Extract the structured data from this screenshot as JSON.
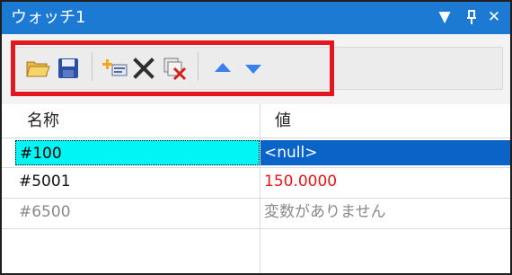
{
  "window": {
    "title": "ウォッチ1",
    "controls": {
      "dropdown": "▼",
      "pin": "ᵖ",
      "close": "✕"
    }
  },
  "toolbar": {
    "buttons": [
      {
        "icon": "open-folder-icon"
      },
      {
        "icon": "save-icon"
      },
      {
        "icon": "add-watch-icon"
      },
      {
        "icon": "delete-icon"
      },
      {
        "icon": "delete-all-icon"
      },
      {
        "icon": "move-up-icon"
      },
      {
        "icon": "move-down-icon"
      }
    ]
  },
  "table": {
    "headers": {
      "name": "名称",
      "value": "値"
    },
    "rows": [
      {
        "name": "#100",
        "value": "<null>",
        "selected": true
      },
      {
        "name": "#5001",
        "value": "150.0000",
        "value_color": "#e0161c"
      },
      {
        "name": "#6500",
        "value": "変数がありません",
        "muted": true
      }
    ]
  },
  "colors": {
    "titlebar": "#1c7ad3",
    "selection_name": "#00f5f5",
    "selection_value": "#0a64c8",
    "highlight_border": "#e3171f"
  }
}
